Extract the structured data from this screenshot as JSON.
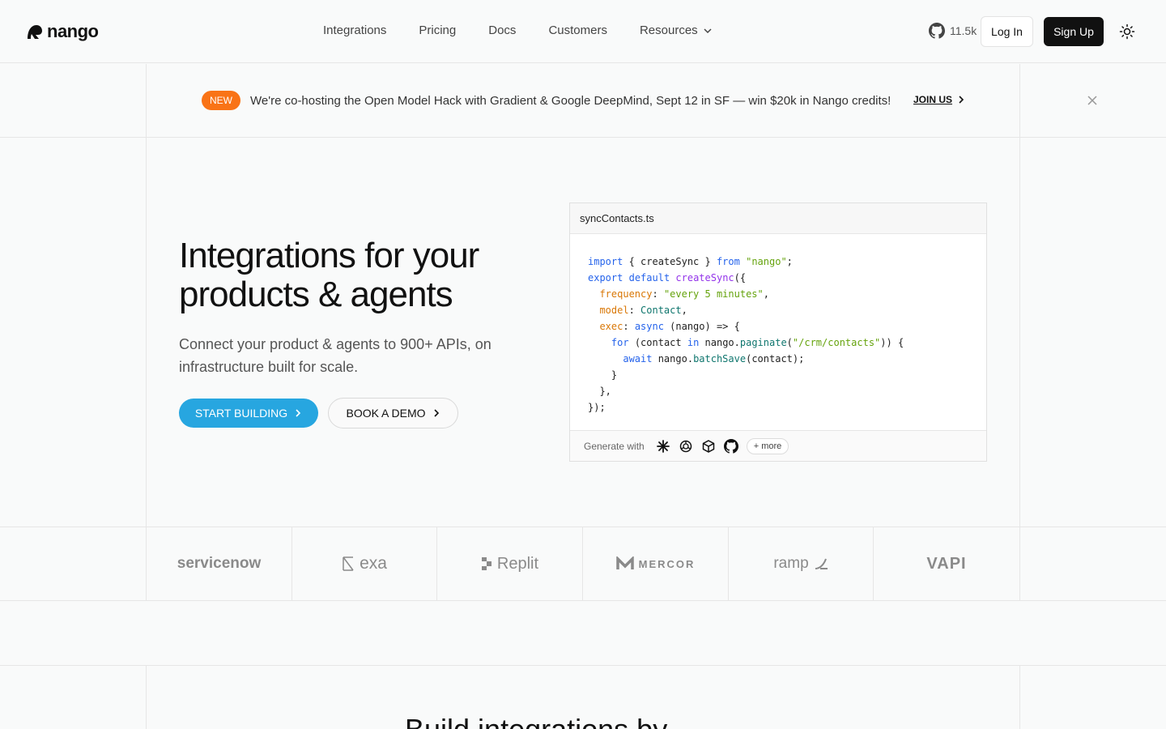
{
  "header": {
    "brand": "nango",
    "nav": [
      "Integrations",
      "Pricing",
      "Docs",
      "Customers"
    ],
    "resources_label": "Resources",
    "github_stars": "11.5k",
    "login_label": "Log In",
    "signup_label": "Sign Up"
  },
  "announcement": {
    "badge": "NEW",
    "text": "We're co-hosting the Open Model Hack with Gradient & Google DeepMind, Sept 12 in SF — win $20k in Nango credits!",
    "cta": "JOIN US"
  },
  "hero": {
    "title_line1": "Integrations for your",
    "title_line2": "products & agents",
    "subtitle": "Connect your product & agents to 900+ APIs, on infrastructure built for scale.",
    "primary_cta": "START BUILDING",
    "secondary_cta": "BOOK A DEMO"
  },
  "code": {
    "filename": "syncContacts.ts",
    "generate_label": "Generate with",
    "more_label": "+ more",
    "generate_icons": [
      "claude-icon",
      "openai-icon",
      "cube-icon",
      "github-icon"
    ]
  },
  "logos": [
    "servicenow",
    "exa",
    "Replit",
    "MERCOR",
    "ramp",
    "VAPI"
  ],
  "section": {
    "title": "Build integrations by"
  },
  "colors": {
    "accent": "#27a6e0",
    "badge": "#f97316",
    "dark_button": "#111111"
  }
}
